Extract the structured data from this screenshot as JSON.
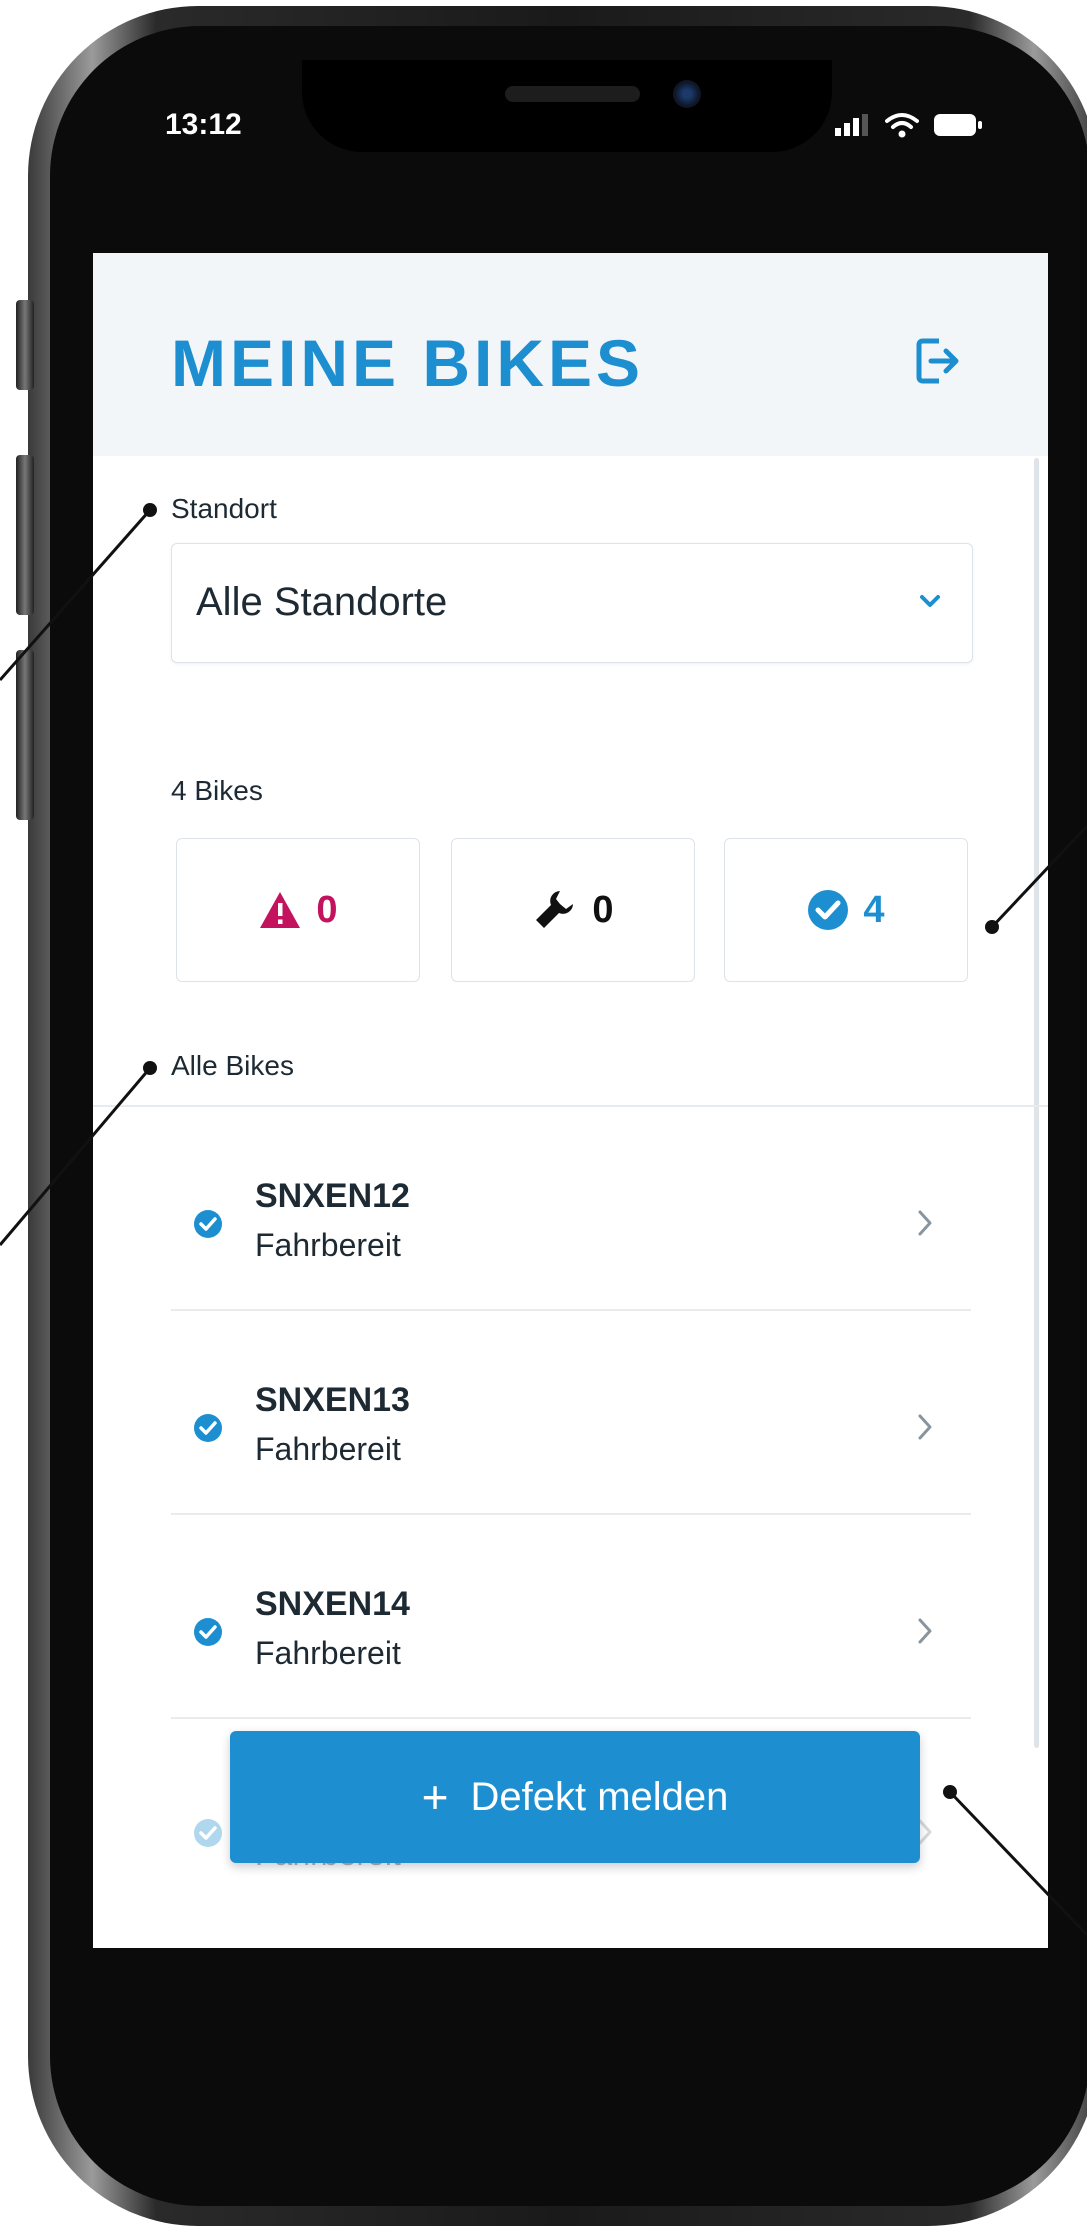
{
  "status_bar": {
    "time": "13:12"
  },
  "header": {
    "title": "MEINE BIKES"
  },
  "location": {
    "label": "Standort",
    "selected": "Alle Standorte"
  },
  "summary": {
    "count_label": "4 Bikes",
    "stats": [
      {
        "icon": "warning-icon",
        "value": "0",
        "color": "#c4135e"
      },
      {
        "icon": "wrench-icon",
        "value": "0",
        "color": "#111111"
      },
      {
        "icon": "check-circle-icon",
        "value": "4",
        "color": "#1d8fd0"
      }
    ]
  },
  "list": {
    "label": "Alle Bikes",
    "bikes": [
      {
        "name": "SNXEN12",
        "status": "Fahrbereit"
      },
      {
        "name": "SNXEN13",
        "status": "Fahrbereit"
      },
      {
        "name": "SNXEN14",
        "status": "Fahrbereit"
      },
      {
        "name": "",
        "status": "Fahrbereit"
      }
    ]
  },
  "actions": {
    "report_defect": "Defekt melden"
  },
  "colors": {
    "accent": "#1d8fd0",
    "alert": "#c4135e",
    "header_bg": "#f3f6f9"
  }
}
